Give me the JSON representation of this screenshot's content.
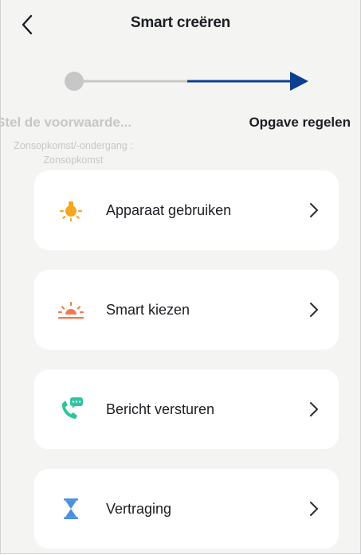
{
  "header": {
    "title": "Smart creëren"
  },
  "steps": {
    "left_label": "Stel de voorwaarde...",
    "left_sub_line1": "Zonsopkomst/-ondergang :",
    "left_sub_line2": "Zonsopkomst",
    "right_label": "Opgave regelen"
  },
  "options": [
    {
      "label": "Apparaat gebruiken",
      "icon": "lightbulb-icon",
      "color": "#f6a623"
    },
    {
      "label": "Smart kiezen",
      "icon": "sunrise-icon",
      "color": "#f07a4e"
    },
    {
      "label": "Bericht versturen",
      "icon": "phone-message-icon",
      "color": "#2ec4a0"
    },
    {
      "label": "Vertraging",
      "icon": "hourglass-icon",
      "color": "#4a8fe0"
    }
  ],
  "colors": {
    "accent": "#0b3f91",
    "inactive": "#c7c7c7"
  }
}
